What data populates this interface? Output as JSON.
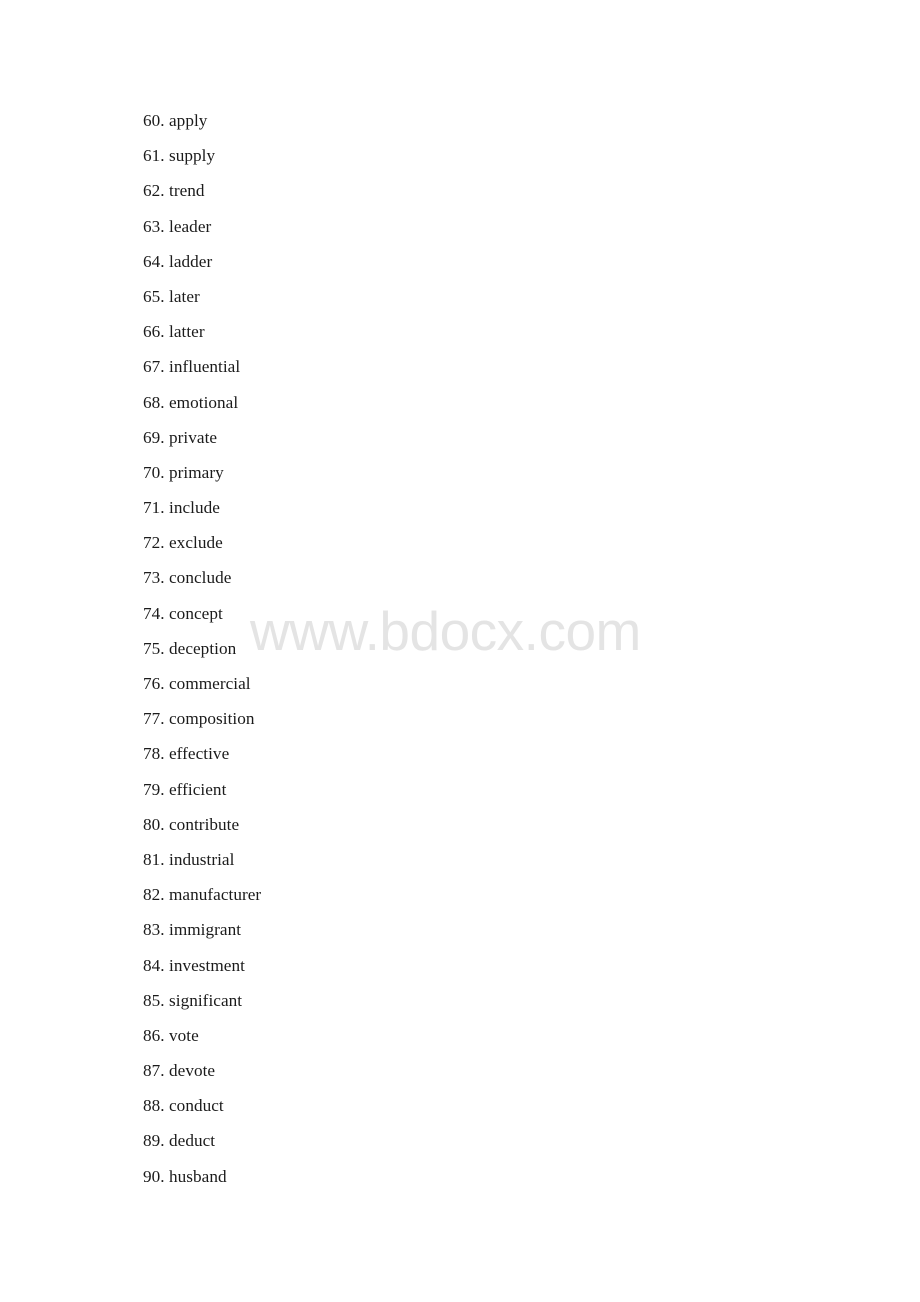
{
  "document": {
    "type": "vocabulary-word-list",
    "background_color": "#ffffff",
    "text_color": "#1b1b1b"
  },
  "watermark": {
    "text": "www.bdocx.com",
    "color": "#e4e4e4"
  },
  "list": {
    "items": [
      {
        "number": "60.",
        "word": "apply"
      },
      {
        "number": "61.",
        "word": "supply"
      },
      {
        "number": "62.",
        "word": "trend"
      },
      {
        "number": "63.",
        "word": "leader"
      },
      {
        "number": "64.",
        "word": "ladder"
      },
      {
        "number": "65.",
        "word": "later"
      },
      {
        "number": "66.",
        "word": "latter"
      },
      {
        "number": "67.",
        "word": "influential"
      },
      {
        "number": "68.",
        "word": "emotional"
      },
      {
        "number": "69.",
        "word": "private"
      },
      {
        "number": "70.",
        "word": "primary"
      },
      {
        "number": "71.",
        "word": "include"
      },
      {
        "number": "72.",
        "word": "exclude"
      },
      {
        "number": "73.",
        "word": "conclude"
      },
      {
        "number": "74.",
        "word": "concept"
      },
      {
        "number": "75.",
        "word": "deception"
      },
      {
        "number": "76.",
        "word": "commercial"
      },
      {
        "number": "77.",
        "word": "composition"
      },
      {
        "number": "78.",
        "word": "effective"
      },
      {
        "number": "79.",
        "word": "efficient"
      },
      {
        "number": "80.",
        "word": "contribute"
      },
      {
        "number": "81.",
        "word": "industrial"
      },
      {
        "number": "82.",
        "word": "manufacturer"
      },
      {
        "number": "83.",
        "word": "immigrant"
      },
      {
        "number": "84.",
        "word": "investment"
      },
      {
        "number": "85.",
        "word": "significant"
      },
      {
        "number": "86.",
        "word": "vote"
      },
      {
        "number": "87.",
        "word": "devote"
      },
      {
        "number": "88.",
        "word": "conduct"
      },
      {
        "number": "89.",
        "word": "deduct"
      },
      {
        "number": "90.",
        "word": "husband"
      }
    ]
  }
}
